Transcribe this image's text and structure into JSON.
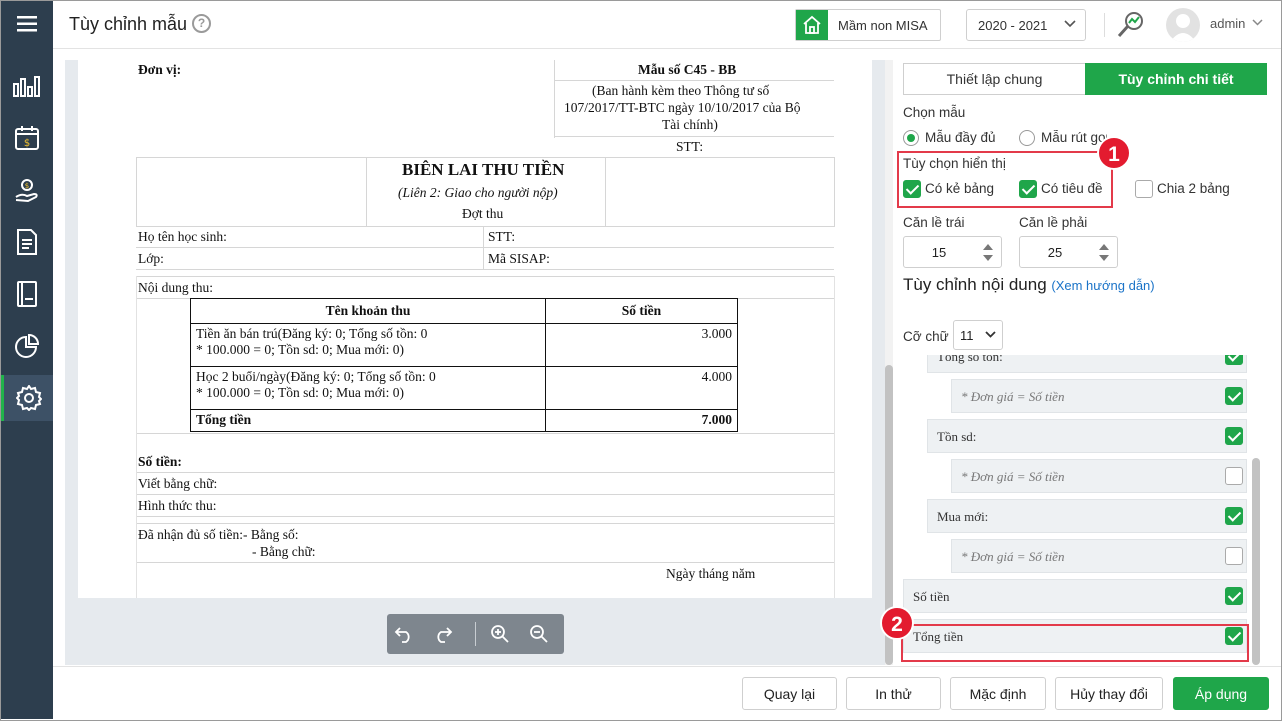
{
  "header": {
    "title": "Tùy chỉnh mẫu",
    "help": "?",
    "school": "Mầm non MISA",
    "year": "2020 - 2021",
    "user": "admin"
  },
  "sidebar": {
    "items": [
      {
        "icon": "chart-bar-icon"
      },
      {
        "icon": "calendar-money-icon"
      },
      {
        "icon": "hand-coin-icon"
      },
      {
        "icon": "document-icon"
      },
      {
        "icon": "book-icon"
      },
      {
        "icon": "pie-chart-icon"
      },
      {
        "icon": "gear-icon",
        "active": true
      }
    ]
  },
  "doc": {
    "don_vi": "Đơn vị:",
    "mau_so": "Mẫu số C45 - BB",
    "ban_hanh_1": "(Ban hành kèm theo Thông tư số",
    "ban_hanh_2": "107/2017/TT-BTC ngày 10/10/2017 của Bộ",
    "ban_hanh_3": "Tài chính)",
    "stt": "STT:",
    "title": "BIÊN LAI THU TIỀN",
    "subtitle": "(Liên 2: Giao cho người nộp)",
    "dot_thu": "Đợt thu",
    "ho_ten": "Họ tên học sinh:",
    "stt2": "STT:",
    "lop": "Lớp:",
    "ma_sisap": "Mã SISAP:",
    "noi_dung": "Nội dung thu:",
    "table": {
      "col_name": "Tên khoản thu",
      "col_amount": "Số tiền",
      "rows": [
        {
          "line1": "Tiền ăn bán trú(Đăng ký: 0;  Tổng số tồn: 0",
          "line2": " * 100.000 = 0;  Tồn sd: 0;  Mua mới: 0)",
          "amount": "3.000"
        },
        {
          "line1": "Học 2 buổi/ngày(Đăng ký: 0;  Tổng số tồn: 0",
          "line2": " * 100.000 = 0;  Tồn sd: 0;  Mua mới: 0)",
          "amount": "4.000"
        }
      ],
      "total_label": "Tổng tiền",
      "total_amount": "7.000"
    },
    "so_tien": "Số tiền:",
    "viet_bang_chu": "Viết bằng chữ:",
    "hinh_thuc": "Hình thức thu:",
    "da_nhan": "Đã nhận đủ số tiền:- Bằng số:",
    "bang_chu": "- Bằng chữ:",
    "ngay": "Ngày      tháng      năm"
  },
  "panel": {
    "tab_general": "Thiết lập chung",
    "tab_detail": "Tùy chỉnh chi tiết",
    "chon_mau": "Chọn mẫu",
    "mau_day_du": "Mẫu đầy đủ",
    "mau_rut_gon": "Mẫu rút gọn",
    "tuy_chon": "Tùy chọn hiển thị",
    "co_ke_bang": "Có kẻ bảng",
    "co_tieu_de": "Có tiêu đề",
    "chia_2_bang": "Chia 2 bảng",
    "can_le_trai": "Căn lề trái",
    "can_le_phai": "Căn lề phải",
    "le_trai": "15",
    "le_phai": "25",
    "tuy_chinh_noi_dung": "Tùy chỉnh nội dung",
    "xem_huong_dan": "(Xem hướng dẫn)",
    "co_chu": "Cỡ chữ",
    "font_size": "11",
    "rows": [
      {
        "label": "Tổng số tồn:",
        "checked": true
      },
      {
        "label": "* Đơn giá = Số tiền",
        "checked": true
      },
      {
        "label": "Tồn sd:",
        "checked": true
      },
      {
        "label": "* Đơn giá = Số tiền",
        "checked": false
      },
      {
        "label": "Mua mới:",
        "checked": true
      },
      {
        "label": "* Đơn giá = Số tiền",
        "checked": false
      },
      {
        "label": "Số tiền",
        "checked": true
      },
      {
        "label": "Tổng tiền",
        "checked": true
      }
    ],
    "badge1": "1",
    "badge2": "2"
  },
  "footer": {
    "back": "Quay lại",
    "print": "In thử",
    "default": "Mặc định",
    "cancel": "Hủy thay đổi",
    "apply": "Áp dụng"
  },
  "colors": {
    "accent": "#1fa64a",
    "rail": "#2d3e4e",
    "highlight": "#e33a4a"
  }
}
